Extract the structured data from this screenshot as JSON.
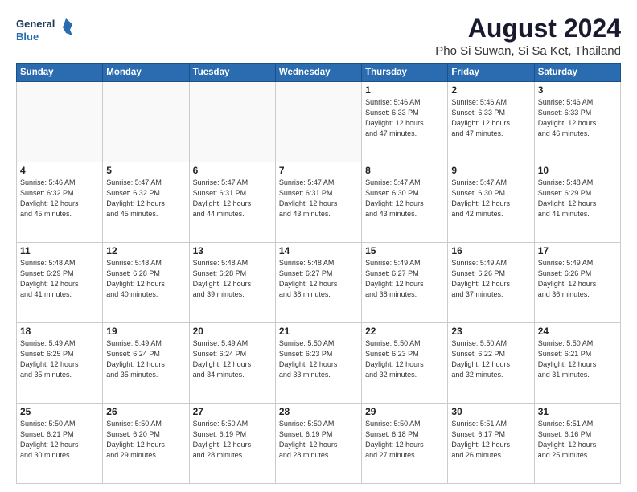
{
  "header": {
    "logo_line1": "General",
    "logo_line2": "Blue",
    "main_title": "August 2024",
    "sub_title": "Pho Si Suwan, Si Sa Ket, Thailand"
  },
  "weekdays": [
    "Sunday",
    "Monday",
    "Tuesday",
    "Wednesday",
    "Thursday",
    "Friday",
    "Saturday"
  ],
  "weeks": [
    [
      {
        "day": "",
        "info": ""
      },
      {
        "day": "",
        "info": ""
      },
      {
        "day": "",
        "info": ""
      },
      {
        "day": "",
        "info": ""
      },
      {
        "day": "1",
        "info": "Sunrise: 5:46 AM\nSunset: 6:33 PM\nDaylight: 12 hours\nand 47 minutes."
      },
      {
        "day": "2",
        "info": "Sunrise: 5:46 AM\nSunset: 6:33 PM\nDaylight: 12 hours\nand 47 minutes."
      },
      {
        "day": "3",
        "info": "Sunrise: 5:46 AM\nSunset: 6:33 PM\nDaylight: 12 hours\nand 46 minutes."
      }
    ],
    [
      {
        "day": "4",
        "info": "Sunrise: 5:46 AM\nSunset: 6:32 PM\nDaylight: 12 hours\nand 45 minutes."
      },
      {
        "day": "5",
        "info": "Sunrise: 5:47 AM\nSunset: 6:32 PM\nDaylight: 12 hours\nand 45 minutes."
      },
      {
        "day": "6",
        "info": "Sunrise: 5:47 AM\nSunset: 6:31 PM\nDaylight: 12 hours\nand 44 minutes."
      },
      {
        "day": "7",
        "info": "Sunrise: 5:47 AM\nSunset: 6:31 PM\nDaylight: 12 hours\nand 43 minutes."
      },
      {
        "day": "8",
        "info": "Sunrise: 5:47 AM\nSunset: 6:30 PM\nDaylight: 12 hours\nand 43 minutes."
      },
      {
        "day": "9",
        "info": "Sunrise: 5:47 AM\nSunset: 6:30 PM\nDaylight: 12 hours\nand 42 minutes."
      },
      {
        "day": "10",
        "info": "Sunrise: 5:48 AM\nSunset: 6:29 PM\nDaylight: 12 hours\nand 41 minutes."
      }
    ],
    [
      {
        "day": "11",
        "info": "Sunrise: 5:48 AM\nSunset: 6:29 PM\nDaylight: 12 hours\nand 41 minutes."
      },
      {
        "day": "12",
        "info": "Sunrise: 5:48 AM\nSunset: 6:28 PM\nDaylight: 12 hours\nand 40 minutes."
      },
      {
        "day": "13",
        "info": "Sunrise: 5:48 AM\nSunset: 6:28 PM\nDaylight: 12 hours\nand 39 minutes."
      },
      {
        "day": "14",
        "info": "Sunrise: 5:48 AM\nSunset: 6:27 PM\nDaylight: 12 hours\nand 38 minutes."
      },
      {
        "day": "15",
        "info": "Sunrise: 5:49 AM\nSunset: 6:27 PM\nDaylight: 12 hours\nand 38 minutes."
      },
      {
        "day": "16",
        "info": "Sunrise: 5:49 AM\nSunset: 6:26 PM\nDaylight: 12 hours\nand 37 minutes."
      },
      {
        "day": "17",
        "info": "Sunrise: 5:49 AM\nSunset: 6:26 PM\nDaylight: 12 hours\nand 36 minutes."
      }
    ],
    [
      {
        "day": "18",
        "info": "Sunrise: 5:49 AM\nSunset: 6:25 PM\nDaylight: 12 hours\nand 35 minutes."
      },
      {
        "day": "19",
        "info": "Sunrise: 5:49 AM\nSunset: 6:24 PM\nDaylight: 12 hours\nand 35 minutes."
      },
      {
        "day": "20",
        "info": "Sunrise: 5:49 AM\nSunset: 6:24 PM\nDaylight: 12 hours\nand 34 minutes."
      },
      {
        "day": "21",
        "info": "Sunrise: 5:50 AM\nSunset: 6:23 PM\nDaylight: 12 hours\nand 33 minutes."
      },
      {
        "day": "22",
        "info": "Sunrise: 5:50 AM\nSunset: 6:23 PM\nDaylight: 12 hours\nand 32 minutes."
      },
      {
        "day": "23",
        "info": "Sunrise: 5:50 AM\nSunset: 6:22 PM\nDaylight: 12 hours\nand 32 minutes."
      },
      {
        "day": "24",
        "info": "Sunrise: 5:50 AM\nSunset: 6:21 PM\nDaylight: 12 hours\nand 31 minutes."
      }
    ],
    [
      {
        "day": "25",
        "info": "Sunrise: 5:50 AM\nSunset: 6:21 PM\nDaylight: 12 hours\nand 30 minutes."
      },
      {
        "day": "26",
        "info": "Sunrise: 5:50 AM\nSunset: 6:20 PM\nDaylight: 12 hours\nand 29 minutes."
      },
      {
        "day": "27",
        "info": "Sunrise: 5:50 AM\nSunset: 6:19 PM\nDaylight: 12 hours\nand 28 minutes."
      },
      {
        "day": "28",
        "info": "Sunrise: 5:50 AM\nSunset: 6:19 PM\nDaylight: 12 hours\nand 28 minutes."
      },
      {
        "day": "29",
        "info": "Sunrise: 5:50 AM\nSunset: 6:18 PM\nDaylight: 12 hours\nand 27 minutes."
      },
      {
        "day": "30",
        "info": "Sunrise: 5:51 AM\nSunset: 6:17 PM\nDaylight: 12 hours\nand 26 minutes."
      },
      {
        "day": "31",
        "info": "Sunrise: 5:51 AM\nSunset: 6:16 PM\nDaylight: 12 hours\nand 25 minutes."
      }
    ]
  ]
}
